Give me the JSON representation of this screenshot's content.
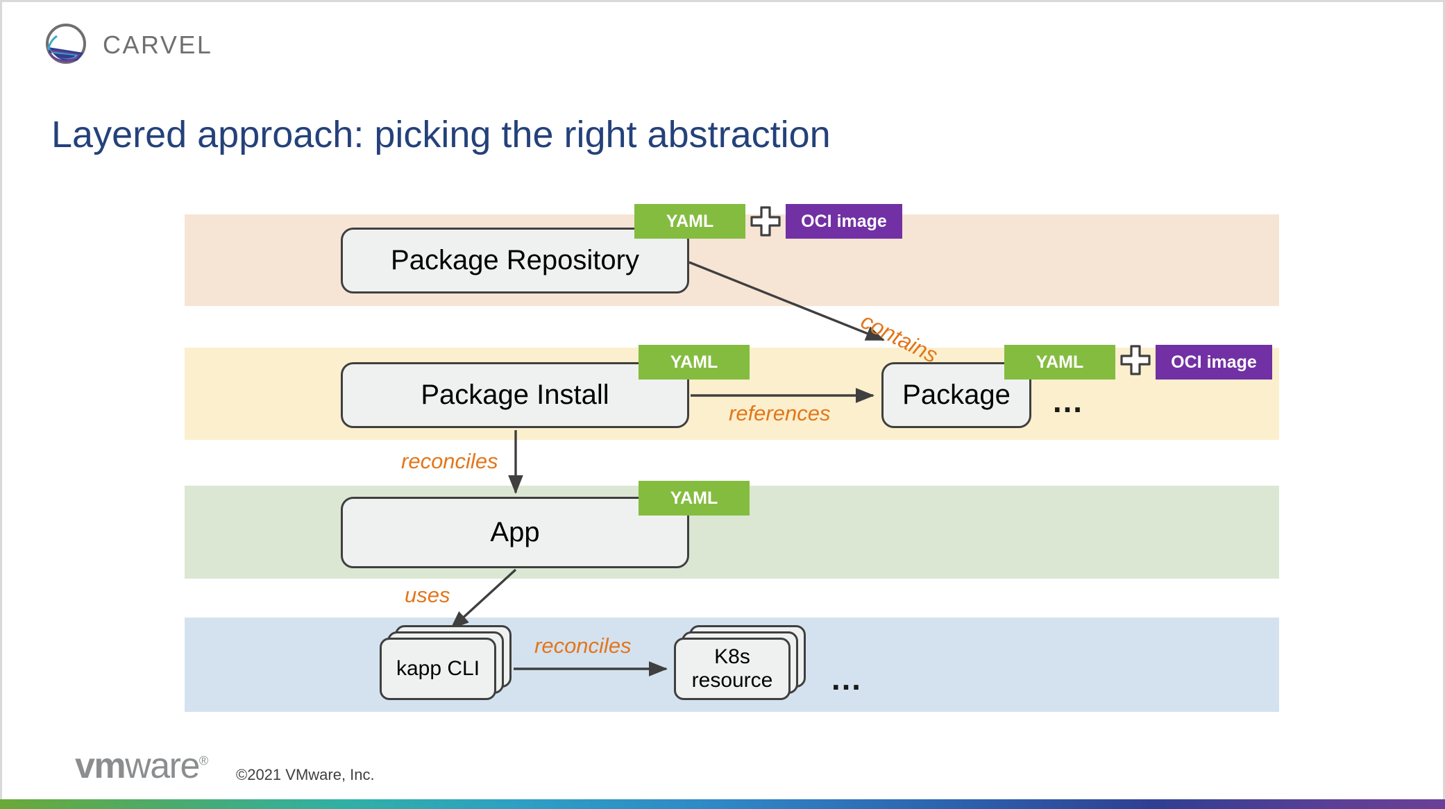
{
  "header": {
    "logo_name": "carvel-logo",
    "wordmark": "CARVEL"
  },
  "title": "Layered approach: picking the right abstraction",
  "bands": [
    {
      "id": "repository",
      "color": "#f6e4d5"
    },
    {
      "id": "install",
      "color": "#fbefcd"
    },
    {
      "id": "app",
      "color": "#dbe7d3"
    },
    {
      "id": "kapp",
      "color": "#d4e2f0"
    }
  ],
  "nodes": {
    "package_repository": "Package Repository",
    "package_install": "Package Install",
    "package": "Package",
    "app": "App",
    "kapp_cli": "kapp CLI",
    "k8s_resource": "K8s\nresource"
  },
  "badges": {
    "yaml": "YAML",
    "oci_image": "OCI image",
    "yaml_color": "#84bc40",
    "oci_color": "#7130a3"
  },
  "relations": {
    "contains": "contains",
    "references": "references",
    "reconciles_app": "reconciles",
    "uses": "uses",
    "reconciles_k8s": "reconciles",
    "label_color": "#e2761b"
  },
  "ellipsis": {
    "package": "…",
    "k8s": "…"
  },
  "footer": {
    "vmware_vm": "vm",
    "vmware_ware": "ware",
    "vmware_reg": "®",
    "copyright": "©2021 VMware, Inc."
  },
  "accents": {
    "title_color": "#24417a",
    "box_fill": "#eff0f0",
    "box_border": "#3f3f3f"
  }
}
